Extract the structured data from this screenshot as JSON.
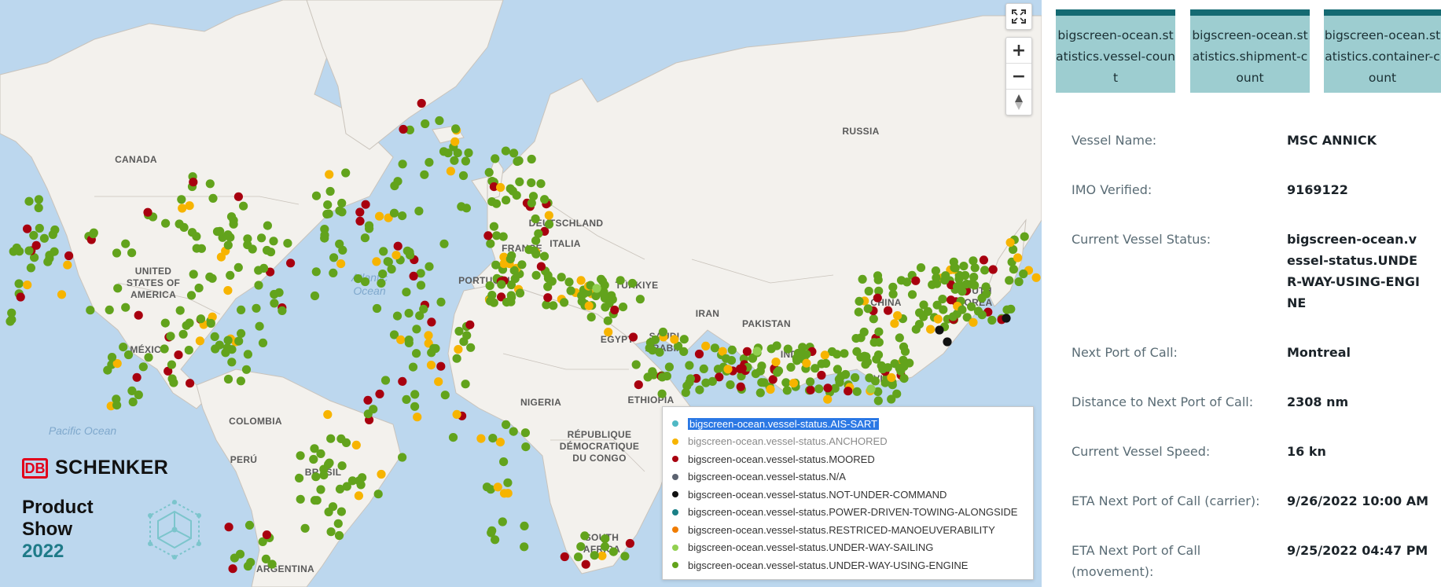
{
  "map": {
    "controls": {
      "fullscreen_icon": "fullscreen-icon",
      "zoom_in": "+",
      "zoom_out": "−",
      "compass_icon": "compass-icon"
    },
    "country_labels": [
      "CANADA",
      "UNITED STATES OF AMERICA",
      "MÉXICO",
      "COLOMBIA",
      "PERÚ",
      "BRASIL",
      "ARGENTINA",
      "RUSSIA",
      "DEUTSCHLAND",
      "FRANCE",
      "PORTUGAL",
      "ITALIA",
      "TÜRKIYE",
      "EGYPT",
      "SAUDI ARABIA",
      "IRAN",
      "PAKISTAN",
      "INDIA",
      "CHINA",
      "SOUTH KOREA",
      "VIET",
      "NIGERIA",
      "ETHIOPIA",
      "RÉPUBLIQUE DÉMOCRATIQUE DU CONGO",
      "SOUTH AFRICA"
    ],
    "ocean_labels": [
      "Atlantic Ocean",
      "Pacific Ocean"
    ],
    "status_colors": {
      "underway": "#62a31c",
      "anchored": "#f7b400",
      "moored": "#a8000f",
      "not_under_command": "#111111",
      "sailing": "#92d050"
    }
  },
  "legend": {
    "items": [
      {
        "label": "bigscreen-ocean.vessel-status.AIS-SART",
        "color": "#4fb8c4",
        "state": "selected"
      },
      {
        "label": "bigscreen-ocean.vessel-status.ANCHORED",
        "color": "#f7b400",
        "state": "muted"
      },
      {
        "label": "bigscreen-ocean.vessel-status.MOORED",
        "color": "#a8000f",
        "state": "normal"
      },
      {
        "label": "bigscreen-ocean.vessel-status.N/A",
        "color": "#5c6370",
        "state": "normal"
      },
      {
        "label": "bigscreen-ocean.vessel-status.NOT-UNDER-COMMAND",
        "color": "#111111",
        "state": "normal"
      },
      {
        "label": "bigscreen-ocean.vessel-status.POWER-DRIVEN-TOWING-ALONGSIDE",
        "color": "#1a7f86",
        "state": "normal"
      },
      {
        "label": "bigscreen-ocean.vessel-status.RESTRICED-MANOEUVERABILITY",
        "color": "#f07c00",
        "state": "normal"
      },
      {
        "label": "bigscreen-ocean.vessel-status.UNDER-WAY-SAILING",
        "color": "#92d050",
        "state": "normal"
      },
      {
        "label": "bigscreen-ocean.vessel-status.UNDER-WAY-USING-ENGINE",
        "color": "#62a31c",
        "state": "normal"
      }
    ]
  },
  "brand": {
    "db": "DB",
    "company": "SCHENKER",
    "event_line1": "Product",
    "event_line2": "Show",
    "year": "2022"
  },
  "panel": {
    "tiles": [
      "bigscreen-ocean.statistics.vessel-count",
      "bigscreen-ocean.statistics.shipment-count",
      "bigscreen-ocean.statistics.container-count"
    ],
    "details": [
      {
        "label": "Vessel Name:",
        "value": "MSC ANNICK"
      },
      {
        "label": "IMO Verified:",
        "value": "9169122"
      },
      {
        "label": "Current Vessel Status:",
        "value": "bigscreen-ocean.vessel-status.UNDER-WAY-USING-ENGINE"
      },
      {
        "label": "Next Port of Call:",
        "value": "Montreal"
      },
      {
        "label": "Distance to Next Port of Call:",
        "value": "2308 nm"
      },
      {
        "label": "Current Vessel Speed:",
        "value": "16 kn"
      },
      {
        "label": "ETA Next Port of Call (carrier):",
        "value": "9/26/2022 10:00 AM"
      },
      {
        "label": "ETA Next Port of Call (movement):",
        "value": "9/25/2022 04:47 PM"
      }
    ]
  }
}
